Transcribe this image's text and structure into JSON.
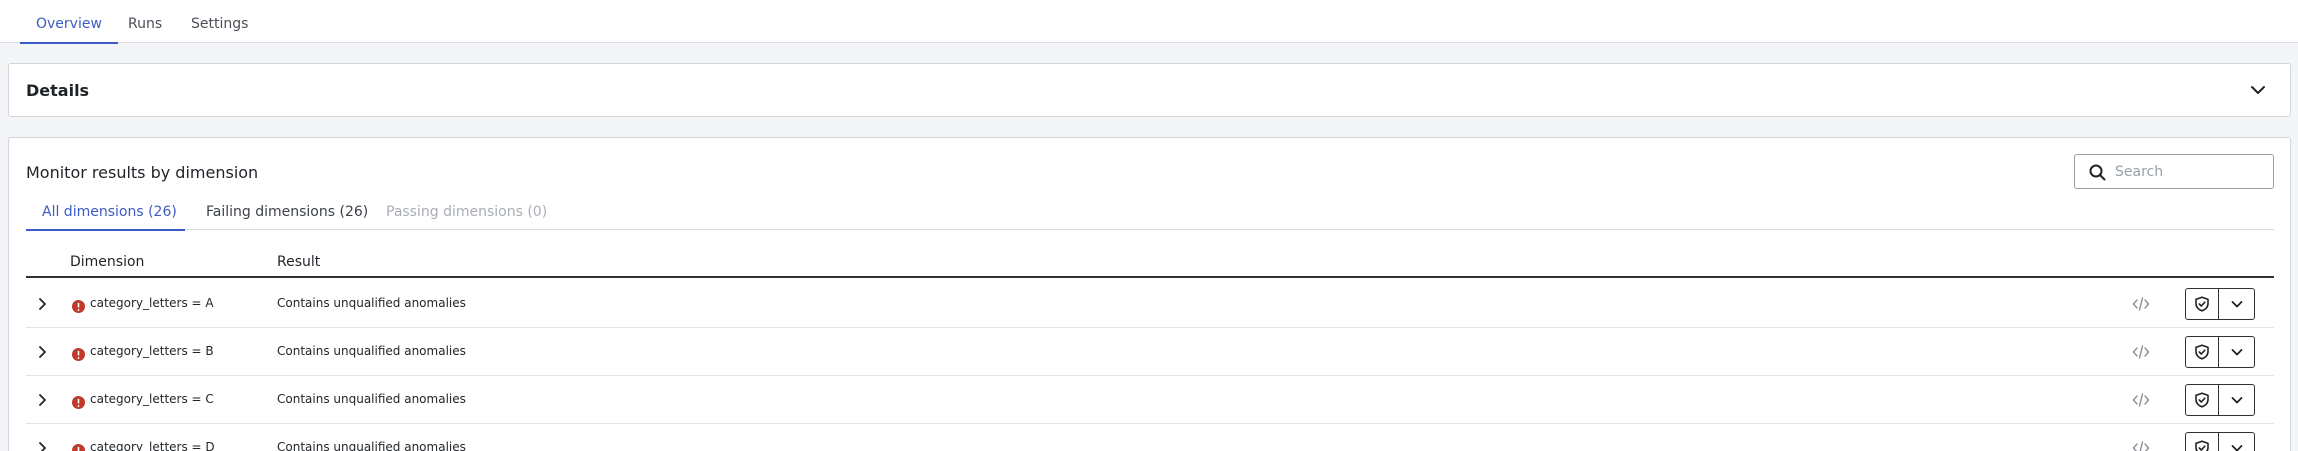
{
  "top_tabs": [
    {
      "label": "Overview",
      "active": true
    },
    {
      "label": "Runs",
      "active": false
    },
    {
      "label": "Settings",
      "active": false
    }
  ],
  "details": {
    "title": "Details"
  },
  "monitor": {
    "title": "Monitor results by dimension",
    "search": {
      "placeholder": "Search",
      "value": ""
    },
    "tabs": [
      {
        "label": "All dimensions (26)",
        "state": "active"
      },
      {
        "label": "Failing dimensions (26)",
        "state": "normal"
      },
      {
        "label": "Passing dimensions (0)",
        "state": "disabled"
      }
    ],
    "columns": {
      "dimension": "Dimension",
      "result": "Result"
    },
    "rows": [
      {
        "dimension": "category_letters = A",
        "result": "Contains unqualified anomalies",
        "status": "error"
      },
      {
        "dimension": "category_letters = B",
        "result": "Contains unqualified anomalies",
        "status": "error"
      },
      {
        "dimension": "category_letters = C",
        "result": "Contains unqualified anomalies",
        "status": "error"
      },
      {
        "dimension": "category_letters = D",
        "result": "Contains unqualified anomalies",
        "status": "error"
      }
    ]
  },
  "colors": {
    "accent": "#3c5bc4",
    "error": "#c0392b",
    "border": "#d2d6dc",
    "background": "#f4f5f7"
  },
  "icons": {
    "details_toggle": "chevron-down-icon",
    "search": "search-icon",
    "row_expand": "chevron-right-icon",
    "row_status": "error-circle-icon",
    "row_code": "code-icon",
    "row_shield": "shield-check-icon",
    "row_menu": "chevron-down-icon"
  }
}
